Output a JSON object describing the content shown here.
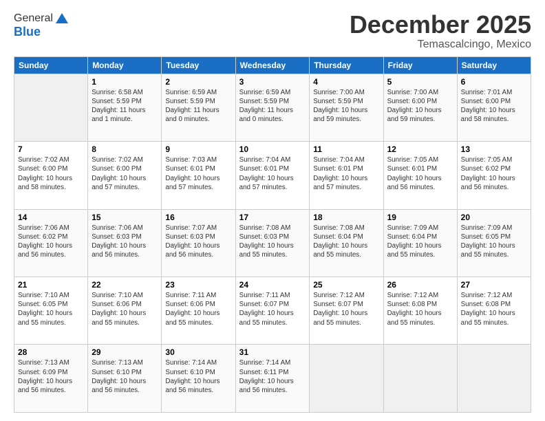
{
  "logo": {
    "general": "General",
    "blue": "Blue"
  },
  "header": {
    "month": "December 2025",
    "location": "Temascalcingo, Mexico"
  },
  "weekdays": [
    "Sunday",
    "Monday",
    "Tuesday",
    "Wednesday",
    "Thursday",
    "Friday",
    "Saturday"
  ],
  "weeks": [
    [
      {
        "day": "",
        "info": ""
      },
      {
        "day": "1",
        "info": "Sunrise: 6:58 AM\nSunset: 5:59 PM\nDaylight: 11 hours\nand 1 minute."
      },
      {
        "day": "2",
        "info": "Sunrise: 6:59 AM\nSunset: 5:59 PM\nDaylight: 11 hours\nand 0 minutes."
      },
      {
        "day": "3",
        "info": "Sunrise: 6:59 AM\nSunset: 5:59 PM\nDaylight: 11 hours\nand 0 minutes."
      },
      {
        "day": "4",
        "info": "Sunrise: 7:00 AM\nSunset: 5:59 PM\nDaylight: 10 hours\nand 59 minutes."
      },
      {
        "day": "5",
        "info": "Sunrise: 7:00 AM\nSunset: 6:00 PM\nDaylight: 10 hours\nand 59 minutes."
      },
      {
        "day": "6",
        "info": "Sunrise: 7:01 AM\nSunset: 6:00 PM\nDaylight: 10 hours\nand 58 minutes."
      }
    ],
    [
      {
        "day": "7",
        "info": "Sunrise: 7:02 AM\nSunset: 6:00 PM\nDaylight: 10 hours\nand 58 minutes."
      },
      {
        "day": "8",
        "info": "Sunrise: 7:02 AM\nSunset: 6:00 PM\nDaylight: 10 hours\nand 57 minutes."
      },
      {
        "day": "9",
        "info": "Sunrise: 7:03 AM\nSunset: 6:01 PM\nDaylight: 10 hours\nand 57 minutes."
      },
      {
        "day": "10",
        "info": "Sunrise: 7:04 AM\nSunset: 6:01 PM\nDaylight: 10 hours\nand 57 minutes."
      },
      {
        "day": "11",
        "info": "Sunrise: 7:04 AM\nSunset: 6:01 PM\nDaylight: 10 hours\nand 57 minutes."
      },
      {
        "day": "12",
        "info": "Sunrise: 7:05 AM\nSunset: 6:01 PM\nDaylight: 10 hours\nand 56 minutes."
      },
      {
        "day": "13",
        "info": "Sunrise: 7:05 AM\nSunset: 6:02 PM\nDaylight: 10 hours\nand 56 minutes."
      }
    ],
    [
      {
        "day": "14",
        "info": "Sunrise: 7:06 AM\nSunset: 6:02 PM\nDaylight: 10 hours\nand 56 minutes."
      },
      {
        "day": "15",
        "info": "Sunrise: 7:06 AM\nSunset: 6:03 PM\nDaylight: 10 hours\nand 56 minutes."
      },
      {
        "day": "16",
        "info": "Sunrise: 7:07 AM\nSunset: 6:03 PM\nDaylight: 10 hours\nand 56 minutes."
      },
      {
        "day": "17",
        "info": "Sunrise: 7:08 AM\nSunset: 6:03 PM\nDaylight: 10 hours\nand 55 minutes."
      },
      {
        "day": "18",
        "info": "Sunrise: 7:08 AM\nSunset: 6:04 PM\nDaylight: 10 hours\nand 55 minutes."
      },
      {
        "day": "19",
        "info": "Sunrise: 7:09 AM\nSunset: 6:04 PM\nDaylight: 10 hours\nand 55 minutes."
      },
      {
        "day": "20",
        "info": "Sunrise: 7:09 AM\nSunset: 6:05 PM\nDaylight: 10 hours\nand 55 minutes."
      }
    ],
    [
      {
        "day": "21",
        "info": "Sunrise: 7:10 AM\nSunset: 6:05 PM\nDaylight: 10 hours\nand 55 minutes."
      },
      {
        "day": "22",
        "info": "Sunrise: 7:10 AM\nSunset: 6:06 PM\nDaylight: 10 hours\nand 55 minutes."
      },
      {
        "day": "23",
        "info": "Sunrise: 7:11 AM\nSunset: 6:06 PM\nDaylight: 10 hours\nand 55 minutes."
      },
      {
        "day": "24",
        "info": "Sunrise: 7:11 AM\nSunset: 6:07 PM\nDaylight: 10 hours\nand 55 minutes."
      },
      {
        "day": "25",
        "info": "Sunrise: 7:12 AM\nSunset: 6:07 PM\nDaylight: 10 hours\nand 55 minutes."
      },
      {
        "day": "26",
        "info": "Sunrise: 7:12 AM\nSunset: 6:08 PM\nDaylight: 10 hours\nand 55 minutes."
      },
      {
        "day": "27",
        "info": "Sunrise: 7:12 AM\nSunset: 6:08 PM\nDaylight: 10 hours\nand 55 minutes."
      }
    ],
    [
      {
        "day": "28",
        "info": "Sunrise: 7:13 AM\nSunset: 6:09 PM\nDaylight: 10 hours\nand 56 minutes."
      },
      {
        "day": "29",
        "info": "Sunrise: 7:13 AM\nSunset: 6:10 PM\nDaylight: 10 hours\nand 56 minutes."
      },
      {
        "day": "30",
        "info": "Sunrise: 7:14 AM\nSunset: 6:10 PM\nDaylight: 10 hours\nand 56 minutes."
      },
      {
        "day": "31",
        "info": "Sunrise: 7:14 AM\nSunset: 6:11 PM\nDaylight: 10 hours\nand 56 minutes."
      },
      {
        "day": "",
        "info": ""
      },
      {
        "day": "",
        "info": ""
      },
      {
        "day": "",
        "info": ""
      }
    ]
  ]
}
